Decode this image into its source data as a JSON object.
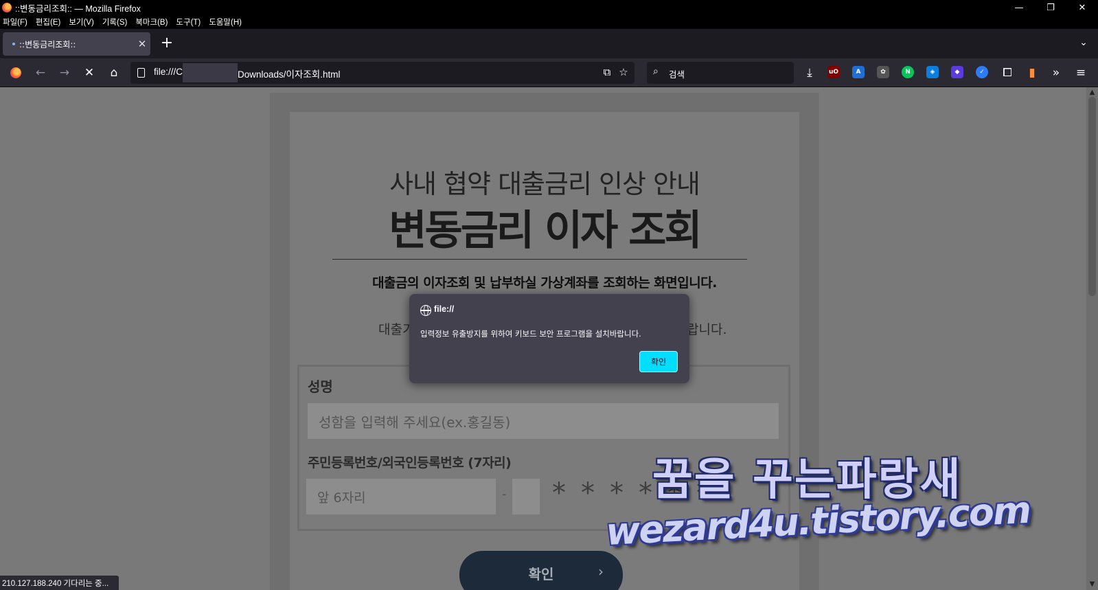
{
  "window": {
    "title": "::변동금리조회:: — Mozilla Firefox",
    "minimize": "—",
    "restore": "❐",
    "close": "✕"
  },
  "menubar": [
    "파일(F)",
    "편집(E)",
    "보기(V)",
    "기록(S)",
    "북마크(B)",
    "도구(T)",
    "도움말(H)"
  ],
  "tab": {
    "label": "::변동금리조회::",
    "close": "✕",
    "new_tab": "+",
    "list_all": "⌄"
  },
  "navbar": {
    "url_prefix": "file:///C",
    "url_suffix": "Downloads/이자조회.html",
    "search_placeholder": "검색",
    "extensions": [
      {
        "name": "ublock",
        "label": "uO",
        "color": "#800000"
      },
      {
        "name": "translate",
        "label": "A",
        "color": "#1f6fd6"
      },
      {
        "name": "puzzle-gray",
        "label": "✿",
        "color": "#555"
      },
      {
        "name": "naver",
        "label": "N",
        "color": "#03c75a"
      },
      {
        "name": "shield",
        "label": "◈",
        "color": "#0b7fe0"
      },
      {
        "name": "diamond",
        "label": "◆",
        "color": "#5b3be0"
      },
      {
        "name": "blue-check",
        "label": "✓",
        "color": "#2d7cf6"
      }
    ]
  },
  "page": {
    "subtitle": "사내 협약 대출금리 인상 안내",
    "title": "변동금리 이자 조회",
    "desc1": "대출금의 이자조회 및 납부하실 가상계좌를 조회하는 화면입니다.",
    "desc2_left": "대출기",
    "desc2_right": "랍니다.",
    "name_label": "성명",
    "name_placeholder": "성함을 입력해 주세요(ex.홍길동)",
    "id_label": "주민등록번호/외국인등록번호 (7자리)",
    "id_front_placeholder": "앞 6자리",
    "id_dash": "-",
    "id_masked": "******",
    "confirm_label": "확인",
    "confirm_chevron": "›"
  },
  "dialog": {
    "origin": "file://",
    "message": "입력정보 유출방지를 위하여 키보드 보안 프로그램을 설치바랍니다.",
    "ok_label": "확인"
  },
  "watermark": {
    "line1": "꿈을 꾸는파랑새",
    "line2": "wezard4u.tistory.com"
  },
  "status": {
    "text": "210.127.188.240 기다리는 중..."
  }
}
